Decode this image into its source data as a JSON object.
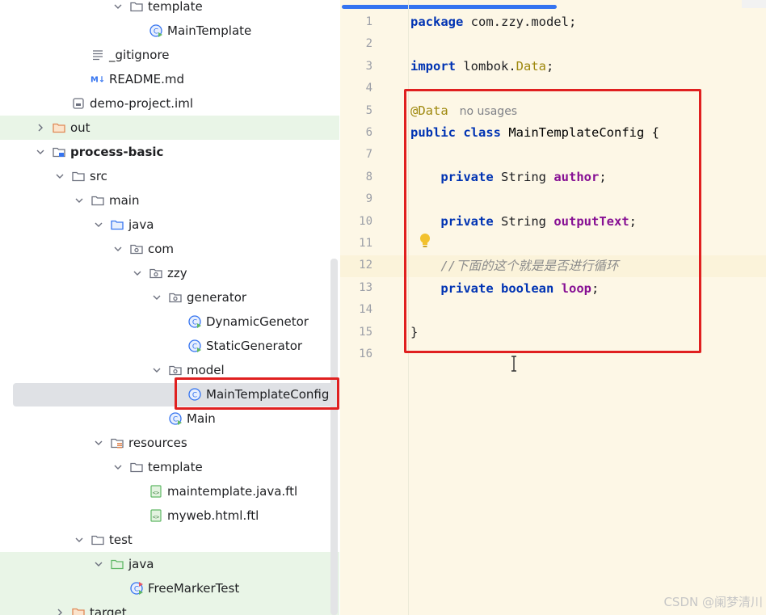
{
  "project_tree": {
    "items": [
      {
        "label": "template",
        "icon": "folder-icon",
        "chev": "expanded",
        "indent": 4,
        "partial": true
      },
      {
        "label": "MainTemplate",
        "icon": "java-main-class-icon",
        "chev": "none",
        "indent": 5
      },
      {
        "label": "_gitignore",
        "icon": "text-file-icon",
        "chev": "none",
        "indent": 2
      },
      {
        "label": "README.md",
        "icon": "markdown-icon",
        "chev": "none",
        "indent": 2
      },
      {
        "label": "demo-project.iml",
        "icon": "iml-file-icon",
        "chev": "none",
        "indent": 1
      },
      {
        "label": "out",
        "icon": "orange-folder-icon",
        "chev": "collapsed",
        "indent": 0,
        "green": true
      },
      {
        "label": "process-basic",
        "icon": "module-folder-icon",
        "chev": "expanded",
        "indent": 0,
        "bold": true
      },
      {
        "label": "src",
        "icon": "folder-icon",
        "chev": "expanded",
        "indent": 1
      },
      {
        "label": "main",
        "icon": "folder-icon",
        "chev": "expanded",
        "indent": 2
      },
      {
        "label": "java",
        "icon": "source-root-icon",
        "chev": "expanded",
        "indent": 3
      },
      {
        "label": "com",
        "icon": "package-icon",
        "chev": "expanded",
        "indent": 4
      },
      {
        "label": "zzy",
        "icon": "package-icon",
        "chev": "expanded",
        "indent": 5
      },
      {
        "label": "generator",
        "icon": "package-icon",
        "chev": "expanded",
        "indent": 6
      },
      {
        "label": "DynamicGenetor",
        "icon": "java-main-class-icon",
        "chev": "none",
        "indent": 7
      },
      {
        "label": "StaticGenerator",
        "icon": "java-main-class-icon",
        "chev": "none",
        "indent": 7
      },
      {
        "label": "model",
        "icon": "package-icon",
        "chev": "expanded",
        "indent": 6
      },
      {
        "label": "MainTemplateConfig",
        "icon": "java-class-icon",
        "chev": "none",
        "indent": 7,
        "selected": true
      },
      {
        "label": "Main",
        "icon": "java-main-class-icon",
        "chev": "none",
        "indent": 6
      },
      {
        "label": "resources",
        "icon": "resources-folder-icon",
        "chev": "expanded",
        "indent": 3
      },
      {
        "label": "template",
        "icon": "folder-icon",
        "chev": "expanded",
        "indent": 4
      },
      {
        "label": "maintemplate.java.ftl",
        "icon": "ftl-file-icon",
        "chev": "none",
        "indent": 5
      },
      {
        "label": "myweb.html.ftl",
        "icon": "ftl-file-icon",
        "chev": "none",
        "indent": 5
      },
      {
        "label": "test",
        "icon": "folder-icon",
        "chev": "expanded",
        "indent": 2
      },
      {
        "label": "java",
        "icon": "test-root-icon",
        "chev": "expanded",
        "indent": 3,
        "green": true
      },
      {
        "label": "FreeMarkerTest",
        "icon": "java-test-class-icon",
        "chev": "none",
        "indent": 4,
        "green": true
      },
      {
        "label": "target",
        "icon": "orange-folder-icon",
        "chev": "collapsed",
        "indent": 1,
        "green": true
      }
    ]
  },
  "editor": {
    "line_numbers": [
      "1",
      "2",
      "3",
      "4",
      "5",
      "6",
      "7",
      "8",
      "9",
      "10",
      "11",
      "12",
      "13",
      "14",
      "15",
      "16"
    ],
    "code": {
      "l1_kw": "package",
      "l1_rest": " com.zzy.model;",
      "l3_kw": "import",
      "l3_pkg": " lombok.",
      "l3_data": "Data",
      "l3_end": ";",
      "l5_ann": "@Data",
      "l5_hint": "no usages",
      "l6_public": "public",
      "l6_class": "class",
      "l6_name": " MainTemplateConfig {",
      "private": "private",
      "string": "String",
      "author": "author",
      "output_text": "outputText",
      "semicolon": ";",
      "comment": "//下面的这个就是是否进行循环",
      "boolean": "boolean",
      "loop": "loop",
      "close_brace": "}"
    }
  },
  "watermark": "CSDN @阑梦清川",
  "colors": {
    "highlight_box": "#e02020",
    "keyword": "#0033b3",
    "annotation": "#9e880d",
    "field": "#871094",
    "editor_bg": "#fdf7e6",
    "selection": "#dfe1e5",
    "test_green": "#e9f5e7"
  }
}
